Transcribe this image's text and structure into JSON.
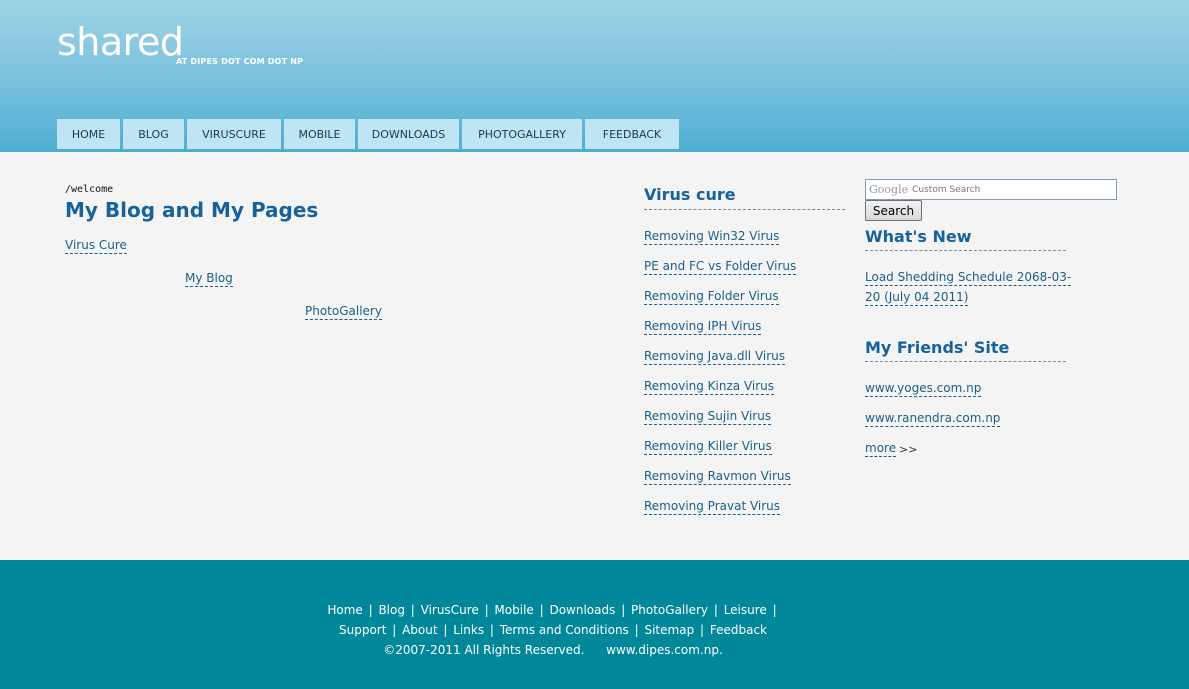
{
  "header": {
    "title": "shared",
    "tagline": "AT DIPES DOT COM DOT NP"
  },
  "nav": {
    "items": [
      {
        "label": "HOME",
        "name": "nav-home"
      },
      {
        "label": "BLOG",
        "name": "nav-blog"
      },
      {
        "label": "VIRUSCURE",
        "name": "nav-viruscure"
      },
      {
        "label": "MOBILE",
        "name": "nav-mobile"
      },
      {
        "label": "DOWNLOADS",
        "name": "nav-downloads"
      },
      {
        "label": "PHOTOGALLERY",
        "name": "nav-photogallery"
      },
      {
        "label": "FEEDBACK",
        "name": "nav-feedback"
      }
    ]
  },
  "main": {
    "breadcrumb": "/welcome",
    "title": "My Blog and My Pages",
    "links": [
      "Virus Cure",
      "My Blog",
      "PhotoGallery"
    ]
  },
  "virus_cure": {
    "title": "Virus cure",
    "links": [
      "Removing Win32 Virus",
      "PE and FC vs Folder Virus",
      "Removing Folder Virus",
      "Removing IPH Virus",
      "Removing Java.dll Virus",
      "Removing Kinza Virus",
      "Removing Sujin Virus",
      "Removing Killer Virus",
      "Removing Ravmon Virus",
      "Removing Pravat Virus"
    ]
  },
  "search": {
    "google": "Google",
    "custom_search": "Custom Search",
    "button": "Search"
  },
  "whats_new": {
    "title": "What's New",
    "line1": "Load Shedding Schedule 2068-03-",
    "line2": "20 (July 04 2011)"
  },
  "friends": {
    "title": "My Friends' Site",
    "links": [
      "www.yoges.com.np",
      "www.ranendra.com.np"
    ],
    "more": "more",
    "more_arrows": ">>"
  },
  "footer": {
    "line1": [
      "Home",
      "Blog",
      "VirusCure",
      "Mobile",
      "Downloads",
      "PhotoGallery",
      "Leisure"
    ],
    "line2": [
      "Support",
      "About",
      "Links",
      "Terms and Conditions",
      "Sitemap",
      "Feedback"
    ],
    "copyright": "©2007-2011 All Rights Reserved.",
    "domain": "www.dipes.com.np."
  },
  "colors": {
    "header_top": "#9fd3e6",
    "header_bottom": "#4daed2",
    "nav_bg": "#bfe4f3",
    "heading_blue": "#17629b",
    "footer_bg": "#00889a"
  }
}
